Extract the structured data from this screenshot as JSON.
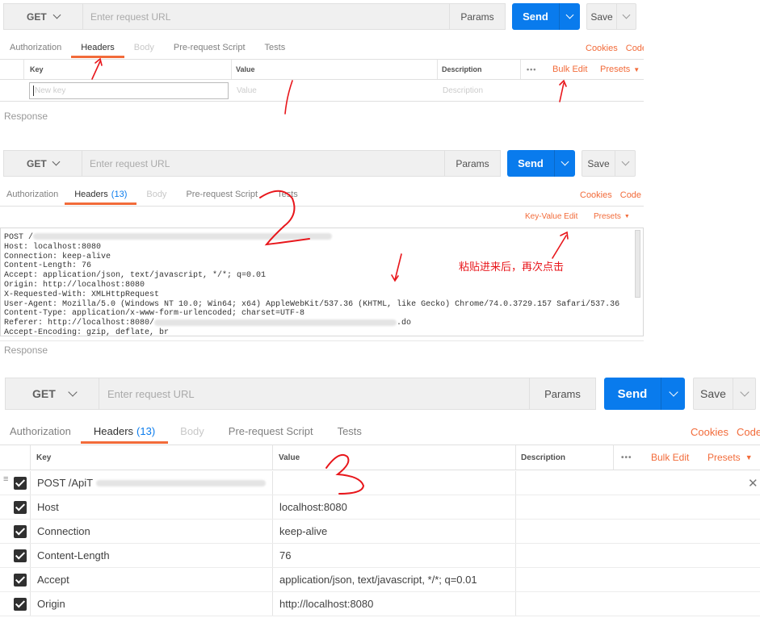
{
  "request": {
    "method": "GET",
    "url_placeholder": "Enter request URL",
    "params_label": "Params",
    "send_label": "Send",
    "save_label": "Save"
  },
  "tabs": {
    "authorization": "Authorization",
    "headers": "Headers",
    "headers_count": "(13)",
    "body": "Body",
    "prerequest": "Pre-request Script",
    "tests": "Tests",
    "cookies": "Cookies",
    "code": "Code"
  },
  "table": {
    "key_header": "Key",
    "value_header": "Value",
    "description_header": "Description",
    "more": "•••",
    "bulk_edit": "Bulk Edit",
    "keyvalue_edit": "Key-Value Edit",
    "presets": "Presets",
    "new_key_placeholder": "New key",
    "value_placeholder": "Value",
    "description_placeholder": "Description"
  },
  "response_label": "Response",
  "bulk_text": {
    "line1_prefix": "POST /",
    "lines": [
      "Host: localhost:8080",
      "Connection: keep-alive",
      "Content-Length: 76",
      "Accept: application/json, text/javascript, */*; q=0.01",
      "Origin: http://localhost:8080",
      "X-Requested-With: XMLHttpRequest",
      "User-Agent: Mozilla/5.0 (Windows NT 10.0; Win64; x64) AppleWebKit/537.36 (KHTML, like Gecko) Chrome/74.0.3729.157 Safari/537.36",
      "Content-Type: application/x-www-form-urlencoded; charset=UTF-8"
    ],
    "referer_prefix": "Referer: http://localhost:8080/",
    "referer_suffix": ".do",
    "last_line": "Accept-Encoding: gzip, deflate, br"
  },
  "annotation_paste": "粘贴进来后，再次点击",
  "header_rows": [
    {
      "key": "POST /ApiT",
      "value": ""
    },
    {
      "key": "Host",
      "value": "localhost:8080"
    },
    {
      "key": "Connection",
      "value": "keep-alive"
    },
    {
      "key": "Content-Length",
      "value": "76"
    },
    {
      "key": "Accept",
      "value": "application/json, text/javascript, */*; q=0.01"
    },
    {
      "key": "Origin",
      "value": "http://localhost:8080"
    }
  ],
  "handwritten": [
    "1",
    "2",
    "3"
  ],
  "colors": {
    "accent": "#f26b3a",
    "send": "#097bed",
    "annotation_red": "#e8161b"
  }
}
